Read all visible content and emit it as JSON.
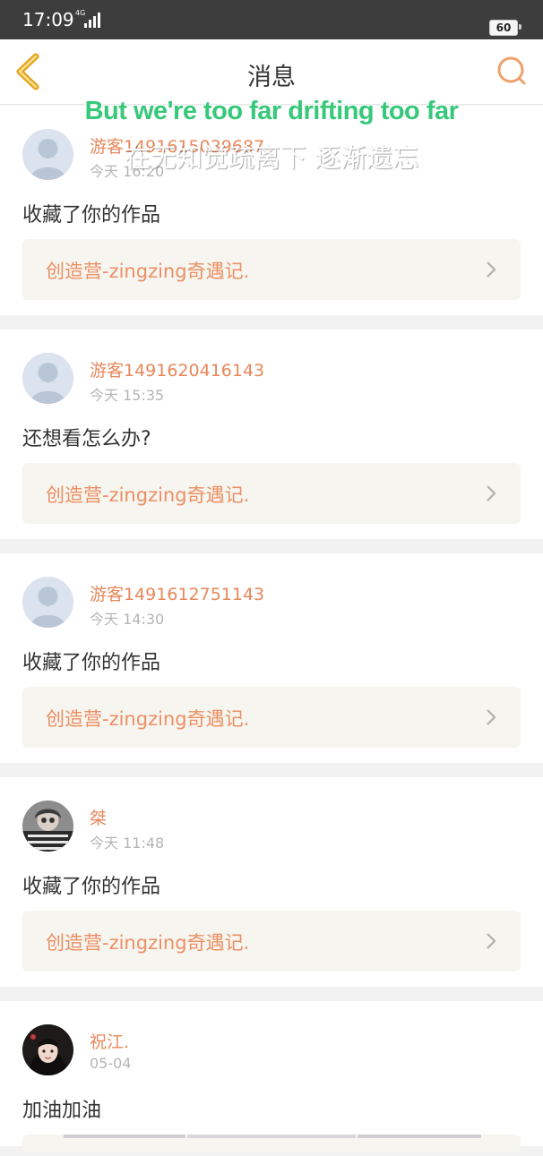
{
  "status_bar": {
    "time": "17:09",
    "signal_label": "4G",
    "battery": "60"
  },
  "nav": {
    "title": "消息",
    "back_icon": "chevron-left-icon",
    "search_icon": "search-icon"
  },
  "overlay": {
    "english": "But we're too far drifting too far",
    "chinese": "在无知觉疏离下 逐渐遗忘"
  },
  "notifications": [
    {
      "username": "游客1491615039687",
      "time": "今天 16:20",
      "message": "收藏了你的作品",
      "work": "创造营-zingzing奇遇记.",
      "avatar": "default-avatar"
    },
    {
      "username": "游客1491620416143",
      "time": "今天 15:35",
      "message": "还想看怎么办?",
      "work": "创造营-zingzing奇遇记.",
      "avatar": "default-avatar"
    },
    {
      "username": "游客1491612751143",
      "time": "今天 14:30",
      "message": "收藏了你的作品",
      "work": "创造营-zingzing奇遇记.",
      "avatar": "default-avatar"
    },
    {
      "username": "桀",
      "time": "今天 11:48",
      "message": "收藏了你的作品",
      "work": "创造营-zingzing奇遇记.",
      "avatar": "photo-avatar"
    },
    {
      "username": "祝江.",
      "time": "05-04",
      "message": "加油加油",
      "work": "",
      "avatar": "photo-avatar"
    }
  ],
  "colors": {
    "accent": "#e8875a",
    "link_bg": "#f6f5ef",
    "status_bar_bg": "#3d3d3d",
    "overlay_green": "#37c87a"
  }
}
